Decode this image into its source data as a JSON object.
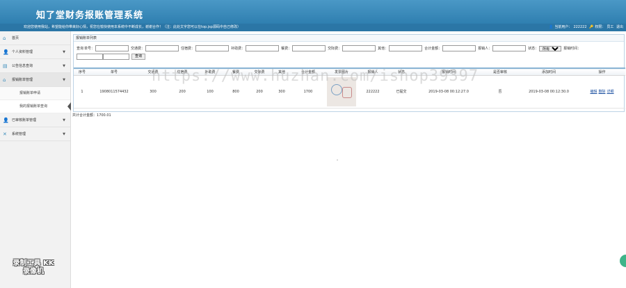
{
  "header": {
    "title": "知了堂财务报账管理系统",
    "welcome": "欢迎您使用我站，希望能给你带来好心情，祝您在愉快使用本系统中不断成长，谢谢合作！（注：此处文字您可以在top.jsp源码中自己修改）",
    "current_user_label": "当前用户：",
    "current_user": "222222",
    "role_label": "权限：",
    "role": "员工",
    "logout": "退出"
  },
  "sidebar": {
    "items": [
      {
        "label": "首页",
        "icon": "home-icon"
      },
      {
        "label": "个人资料管理",
        "icon": "user-icon"
      },
      {
        "label": "公告信息查询",
        "icon": "folder-icon"
      },
      {
        "label": "报销账单管理",
        "icon": "home-icon"
      },
      {
        "label": "已审核账单管理",
        "icon": "user-icon"
      },
      {
        "label": "系统管理",
        "icon": "wrench-icon"
      }
    ],
    "sub_items": [
      {
        "label": "报销账单申请"
      },
      {
        "label": "我的报销账单查询"
      }
    ],
    "watermark": "录制工具 KK录像机"
  },
  "panel": {
    "title": "报销账单列表",
    "filters": {
      "query_label": "查询",
      "bill_no": "单号：",
      "traffic_fee": "交通费：",
      "accommodation_fee": "住宿费：",
      "subsidy_fee": "补助费：",
      "meal_fee": "餐费：",
      "reception_fee": "交际费：",
      "other": "其他：",
      "total_amount": "合计金额：",
      "reimburser": "报销人：",
      "status": "状态：",
      "status_selected": "所有",
      "time": "报销时间：",
      "search_button": "查询"
    },
    "columns": [
      "序号",
      "单号",
      "交通费",
      "住宿费",
      "补助费",
      "餐费",
      "交际费",
      "其他",
      "合计金额",
      "发票图片",
      "报销人",
      "状态",
      "报销时间",
      "是否审核",
      "添加时间",
      "操作"
    ],
    "rows": [
      {
        "index": "1",
        "bill_no": "1908011574432",
        "traffic": "300",
        "accommodation": "200",
        "subsidy": "100",
        "meal": "800",
        "reception": "200",
        "other": "300",
        "total": "1700",
        "reimburser": "222222",
        "status": "已提交",
        "time": "2019-03-08 00:12:27.0",
        "audited": "否",
        "added": "2019-03-08 00:12:30.0",
        "actions": [
          "编辑",
          "删除",
          "详细"
        ]
      }
    ],
    "total_label": "共计合计金额：",
    "total_value": "1700.01"
  },
  "overlay": {
    "url_watermark": "https://www.huzhan.com/ishop39397"
  }
}
